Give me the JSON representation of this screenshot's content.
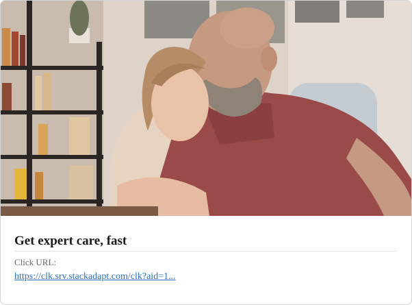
{
  "ad": {
    "image_alt": "Smiling woman hugging an older man with a beard at home",
    "title": "Get expert care, fast",
    "click_url_label": "Click URL:",
    "click_url": "https://clk.srv.stackadapt.com/clk?aid=1..."
  },
  "colors": {
    "title": "#1a1a1a",
    "label": "#666666",
    "link": "#2a6fbf",
    "border": "#d4d4d4"
  }
}
